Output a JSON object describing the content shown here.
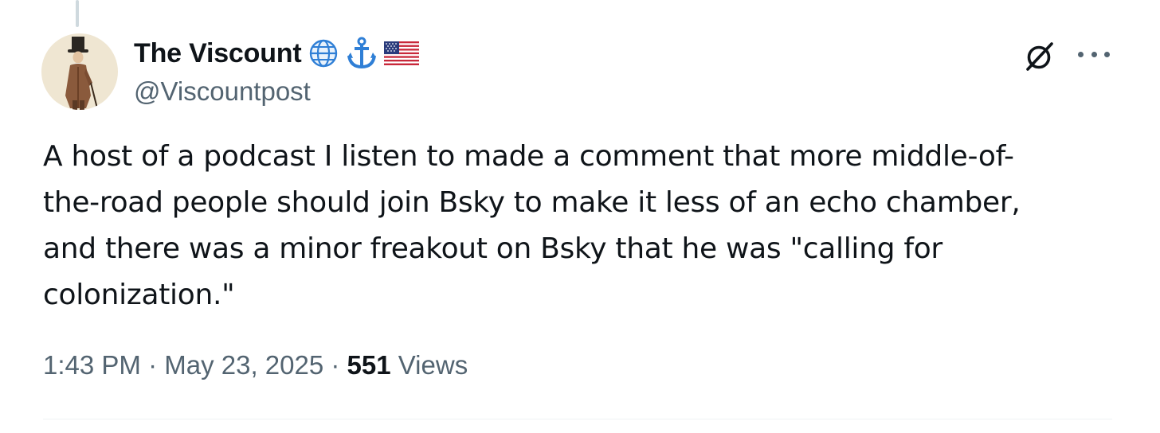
{
  "author": {
    "display_name": "The Viscount",
    "handle": "@Viscountpost",
    "badges": [
      "globe-icon",
      "anchor-icon",
      "us-flag-icon"
    ]
  },
  "actions": {
    "grok_icon": "grok-icon",
    "more_icon": "more-icon"
  },
  "tweet": {
    "text": "A host of a podcast I listen to made a comment that more middle-of-\nthe-road people should join Bsky to make it less of an echo chamber,\nand there was a minor freakout on Bsky that he was \"calling for\ncolonization.\"",
    "time": "1:43 PM",
    "date": "May 23, 2025",
    "separator": " · ",
    "views_count": "551",
    "views_label": "Views"
  },
  "colors": {
    "text_primary": "#0f1419",
    "text_secondary": "#536471",
    "accent_blue": "#1d9bf0",
    "divider": "#eff3f4"
  }
}
